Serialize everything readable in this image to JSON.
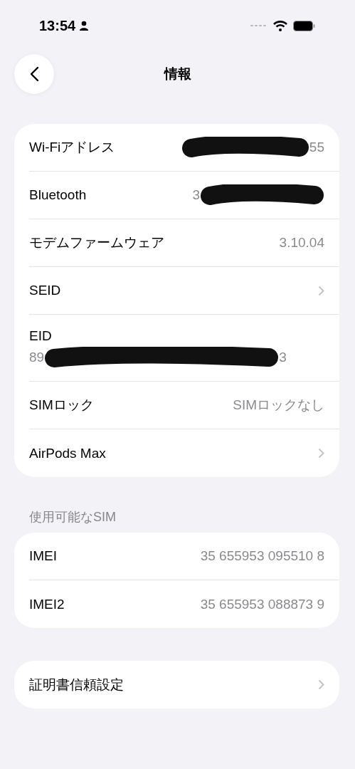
{
  "status_bar": {
    "time": "13:54"
  },
  "nav": {
    "title": "情報"
  },
  "groups": [
    {
      "rows": [
        {
          "kind": "redacted",
          "label": "Wi-Fiアドレス",
          "value_after": "55"
        },
        {
          "kind": "redacted",
          "label": "Bluetooth",
          "value_before": "3"
        },
        {
          "kind": "value",
          "label": "モデムファームウェア",
          "value": "3.10.04"
        },
        {
          "kind": "chevron",
          "label": "SEID"
        },
        {
          "kind": "stacked_redacted",
          "label": "EID",
          "value_before": "89",
          "value_after": "3"
        },
        {
          "kind": "value",
          "label": "SIMロック",
          "value": "SIMロックなし"
        },
        {
          "kind": "chevron",
          "label": "AirPods Max"
        }
      ]
    },
    {
      "header": "使用可能なSIM",
      "rows": [
        {
          "kind": "value",
          "label": "IMEI",
          "value": "35 655953 095510 8"
        },
        {
          "kind": "value",
          "label": "IMEI2",
          "value": "35 655953 088873 9"
        }
      ]
    },
    {
      "rows": [
        {
          "kind": "chevron",
          "label": "証明書信頼設定"
        }
      ]
    }
  ]
}
